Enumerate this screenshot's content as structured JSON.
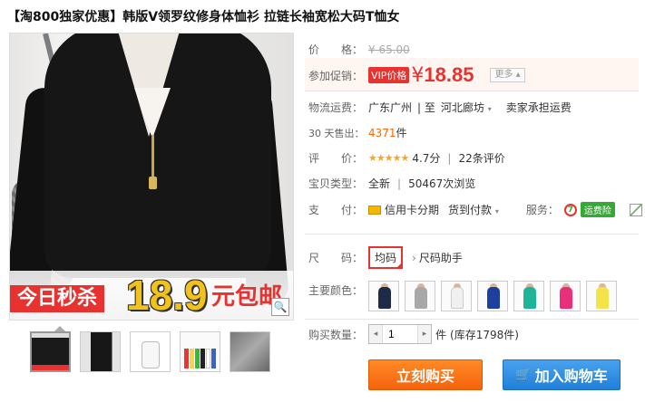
{
  "title": "【淘800独家优惠】韩版V领罗纹修身体恤衫 拉链长袖宽松大码T恤女",
  "gallery": {
    "promo_tag": "今日秒杀",
    "promo_price": "18.9",
    "promo_suffix": "元包邮",
    "zoom_icon": "magnifier-icon",
    "thumbnail_count": 5
  },
  "price": {
    "label": "价　　格：",
    "original": "¥ 65.00"
  },
  "promotion": {
    "label": "参加促销：",
    "badge": "VIP价格",
    "currency": "¥",
    "value": "18.85",
    "more": "更多"
  },
  "shipping": {
    "label": "物流运费：",
    "from": "广东广州",
    "to_sep": "| 至",
    "to": "河北廊坊",
    "fee": "卖家承担运费"
  },
  "sales": {
    "label": "30 天售出：",
    "count": "4371",
    "unit": "件"
  },
  "rating": {
    "label": "评　　价：",
    "stars": "★★★★★",
    "score": "4.7分",
    "sep": "|",
    "reviews": "22条评价"
  },
  "item_type": {
    "label": "宝贝类型：",
    "condition": "全新",
    "sep": "|",
    "views": "50467次浏览"
  },
  "payment": {
    "label": "支　　付：",
    "credit": "信用卡分期",
    "cod": "货到付款",
    "service_label": "服务：",
    "service_badge": "运费险"
  },
  "size": {
    "label": "尺　　码：",
    "selected": "均码",
    "helper": "尺码助手"
  },
  "colors": {
    "label": "主要颜色：",
    "swatches": [
      "#1d2a48",
      "#a8a8a8",
      "#f0f0f0",
      "#1f3fa0",
      "#1fb39a",
      "#ea2f7a",
      "#f4e24a"
    ]
  },
  "quantity": {
    "label": "购买数量：",
    "value": "1",
    "unit": "件",
    "stock": "(库存1798件)"
  },
  "actions": {
    "buy_now": "立刻购买",
    "add_cart": "加入购物车"
  },
  "theme": {
    "accent": "#e8322f",
    "buy": "#f5630c",
    "cart": "#1f7fd8"
  }
}
